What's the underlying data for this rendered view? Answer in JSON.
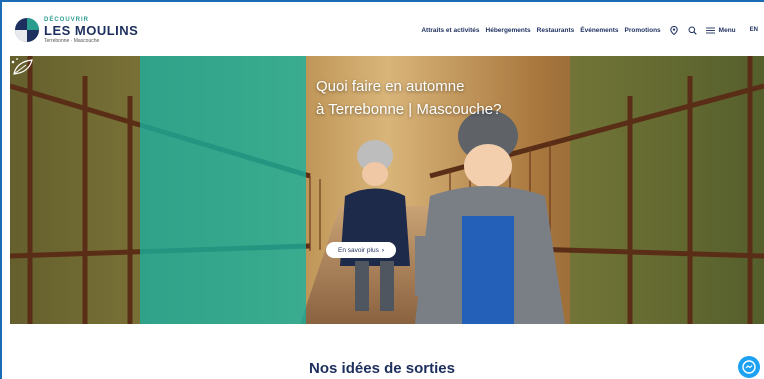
{
  "logo": {
    "top": "DÉCOUVRIR",
    "name": "LES MOULINS",
    "sub": "Terrebonne · Mascouche"
  },
  "nav": {
    "items": [
      "Attraits et activités",
      "Hébergements",
      "Restaurants",
      "Événements",
      "Promotions"
    ],
    "menu_label": "Menu",
    "lang": "EN"
  },
  "icons": {
    "location": "location-pin-icon",
    "search": "search-icon",
    "menu": "hamburger-icon",
    "leaf": "leaf-icon",
    "chat": "messenger-icon"
  },
  "hero": {
    "title_line1": "Quoi faire en automne",
    "title_line2": "à Terrebonne | Mascouche?",
    "cta": "En savoir plus",
    "cta_arrow": "›"
  },
  "section": {
    "title": "Nos idées de sorties"
  },
  "colors": {
    "brand_blue": "#1d2f5e",
    "teal": "#14b2a0",
    "frame_blue": "#1a6db5"
  }
}
